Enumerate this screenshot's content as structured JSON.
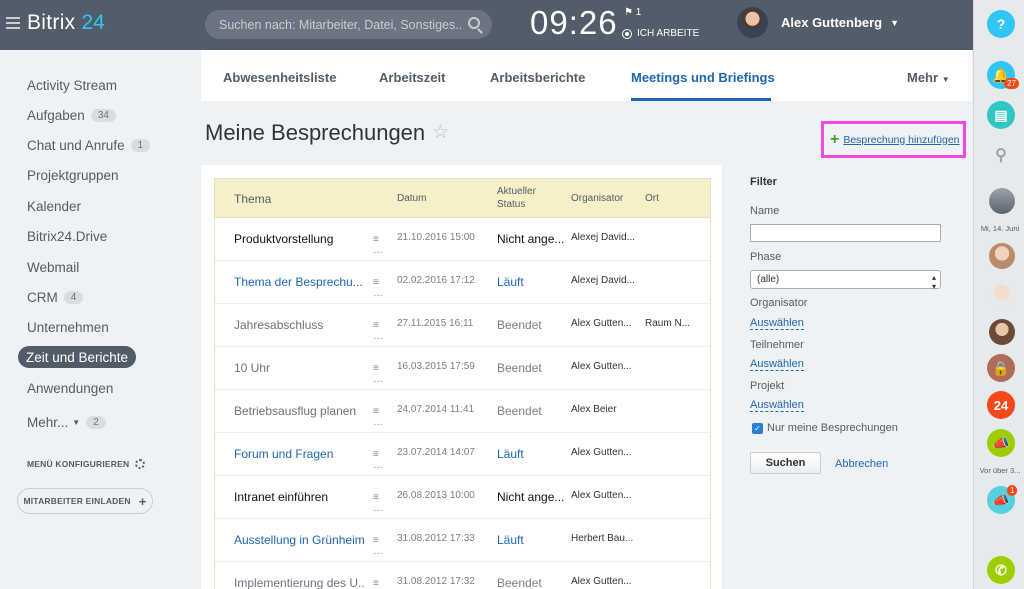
{
  "header": {
    "logo_name": "Bitrix",
    "logo_number": "24",
    "search_placeholder": "Suchen nach: Mitarbeiter, Datei, Sonstiges..",
    "time": "09:26",
    "flag_count": "1",
    "work_status": "ICH ARBEITE",
    "user_name": "Alex Guttenberg"
  },
  "sidebar": {
    "items": [
      {
        "label": "Activity Stream",
        "count": ""
      },
      {
        "label": "Aufgaben",
        "count": "34"
      },
      {
        "label": "Chat und Anrufe",
        "count": "1"
      },
      {
        "label": "Projektgruppen",
        "count": ""
      },
      {
        "label": "Kalender",
        "count": ""
      },
      {
        "label": "Bitrix24.Drive",
        "count": ""
      },
      {
        "label": "Webmail",
        "count": ""
      },
      {
        "label": "CRM",
        "count": "4"
      },
      {
        "label": "Unternehmen",
        "count": ""
      },
      {
        "label": "Zeit und Berichte",
        "count": ""
      },
      {
        "label": "Anwendungen",
        "count": ""
      },
      {
        "label": "Mehr...",
        "count": "2"
      }
    ],
    "configure_label": "MENÜ KONFIGURIEREN",
    "invite_label": "MITARBEITER EINLADEN"
  },
  "tabs": [
    {
      "label": "Abwesenheitsliste"
    },
    {
      "label": "Arbeitszeit"
    },
    {
      "label": "Arbeitsberichte"
    },
    {
      "label": "Meetings und Briefings"
    },
    {
      "label": "Mehr"
    }
  ],
  "page": {
    "title": "Meine Besprechungen",
    "add_label": "Besprechung hinzufügen"
  },
  "table": {
    "headers": {
      "theme": "Thema",
      "date": "Datum",
      "status_1": "Aktueller",
      "status_2": "Status",
      "organizer": "Organisator",
      "place": "Ort"
    },
    "rows": [
      {
        "theme": "Produktvorstellung",
        "date": "21.10.2016 15:00",
        "status": "Nicht ange...",
        "organizer": "Alexej David...",
        "place": "",
        "style": "bold"
      },
      {
        "theme": "Thema der Besprechu...",
        "date": "02.02.2016 17:12",
        "status": "Läuft",
        "organizer": "Alexej David...",
        "place": "",
        "style": "link"
      },
      {
        "theme": "Jahresabschluss",
        "date": "27.11.2015 16:11",
        "status": "Beendet",
        "organizer": "Alex Gutten...",
        "place": "Raum N...",
        "style": "done"
      },
      {
        "theme": "10 Uhr",
        "date": "16.03.2015 17:59",
        "status": "Beendet",
        "organizer": "Alex Gutten...",
        "place": "",
        "style": "done"
      },
      {
        "theme": "Betriebsausflug planen",
        "date": "24.07.2014 11:41",
        "status": "Beendet",
        "organizer": "Alex Beier",
        "place": "",
        "style": "done"
      },
      {
        "theme": "Forum und Fragen",
        "date": "23.07.2014 14:07",
        "status": "Läuft",
        "organizer": "Alex Gutten...",
        "place": "",
        "style": "link"
      },
      {
        "theme": "Intranet einführen",
        "date": "26.08.2013 10:00",
        "status": "Nicht ange...",
        "organizer": "Alex Gutten...",
        "place": "",
        "style": "bold"
      },
      {
        "theme": "Ausstellung in Grünheim",
        "date": "31.08.2012 17:33",
        "status": "Läuft",
        "organizer": "Herbert Bau...",
        "place": "",
        "style": "link"
      },
      {
        "theme": "Implementierung des U...",
        "date": "31.08.2012 17:32",
        "status": "Beendet",
        "organizer": "Alex Gutten...",
        "place": "",
        "style": "done"
      }
    ]
  },
  "filter": {
    "title": "Filter",
    "name_label": "Name",
    "name_value": "",
    "phase_label": "Phase",
    "phase_value": "(alle)",
    "organizer_label": "Organisator",
    "organizer_link": "Auswählen",
    "participants_label": "Teilnehmer",
    "participants_link": "Auswählen",
    "project_label": "Projekt",
    "project_link": "Auswählen",
    "only_mine_label": "Nur meine Besprechungen",
    "search_button": "Suchen",
    "cancel_link": "Abbrechen"
  },
  "rail": {
    "help": "?",
    "notifications_count": "27",
    "date_note": "Mi, 14. Juni",
    "ago_note": "Vor über 3...",
    "chat_badge": "1",
    "bitrix_badge": "24"
  },
  "colors": {
    "header_bg": "#535c69",
    "accent_blue": "#2067b0",
    "table_header_bg": "#f5f0c7",
    "highlight_box": "#ee4ae6",
    "add_plus": "#3fa32b"
  }
}
